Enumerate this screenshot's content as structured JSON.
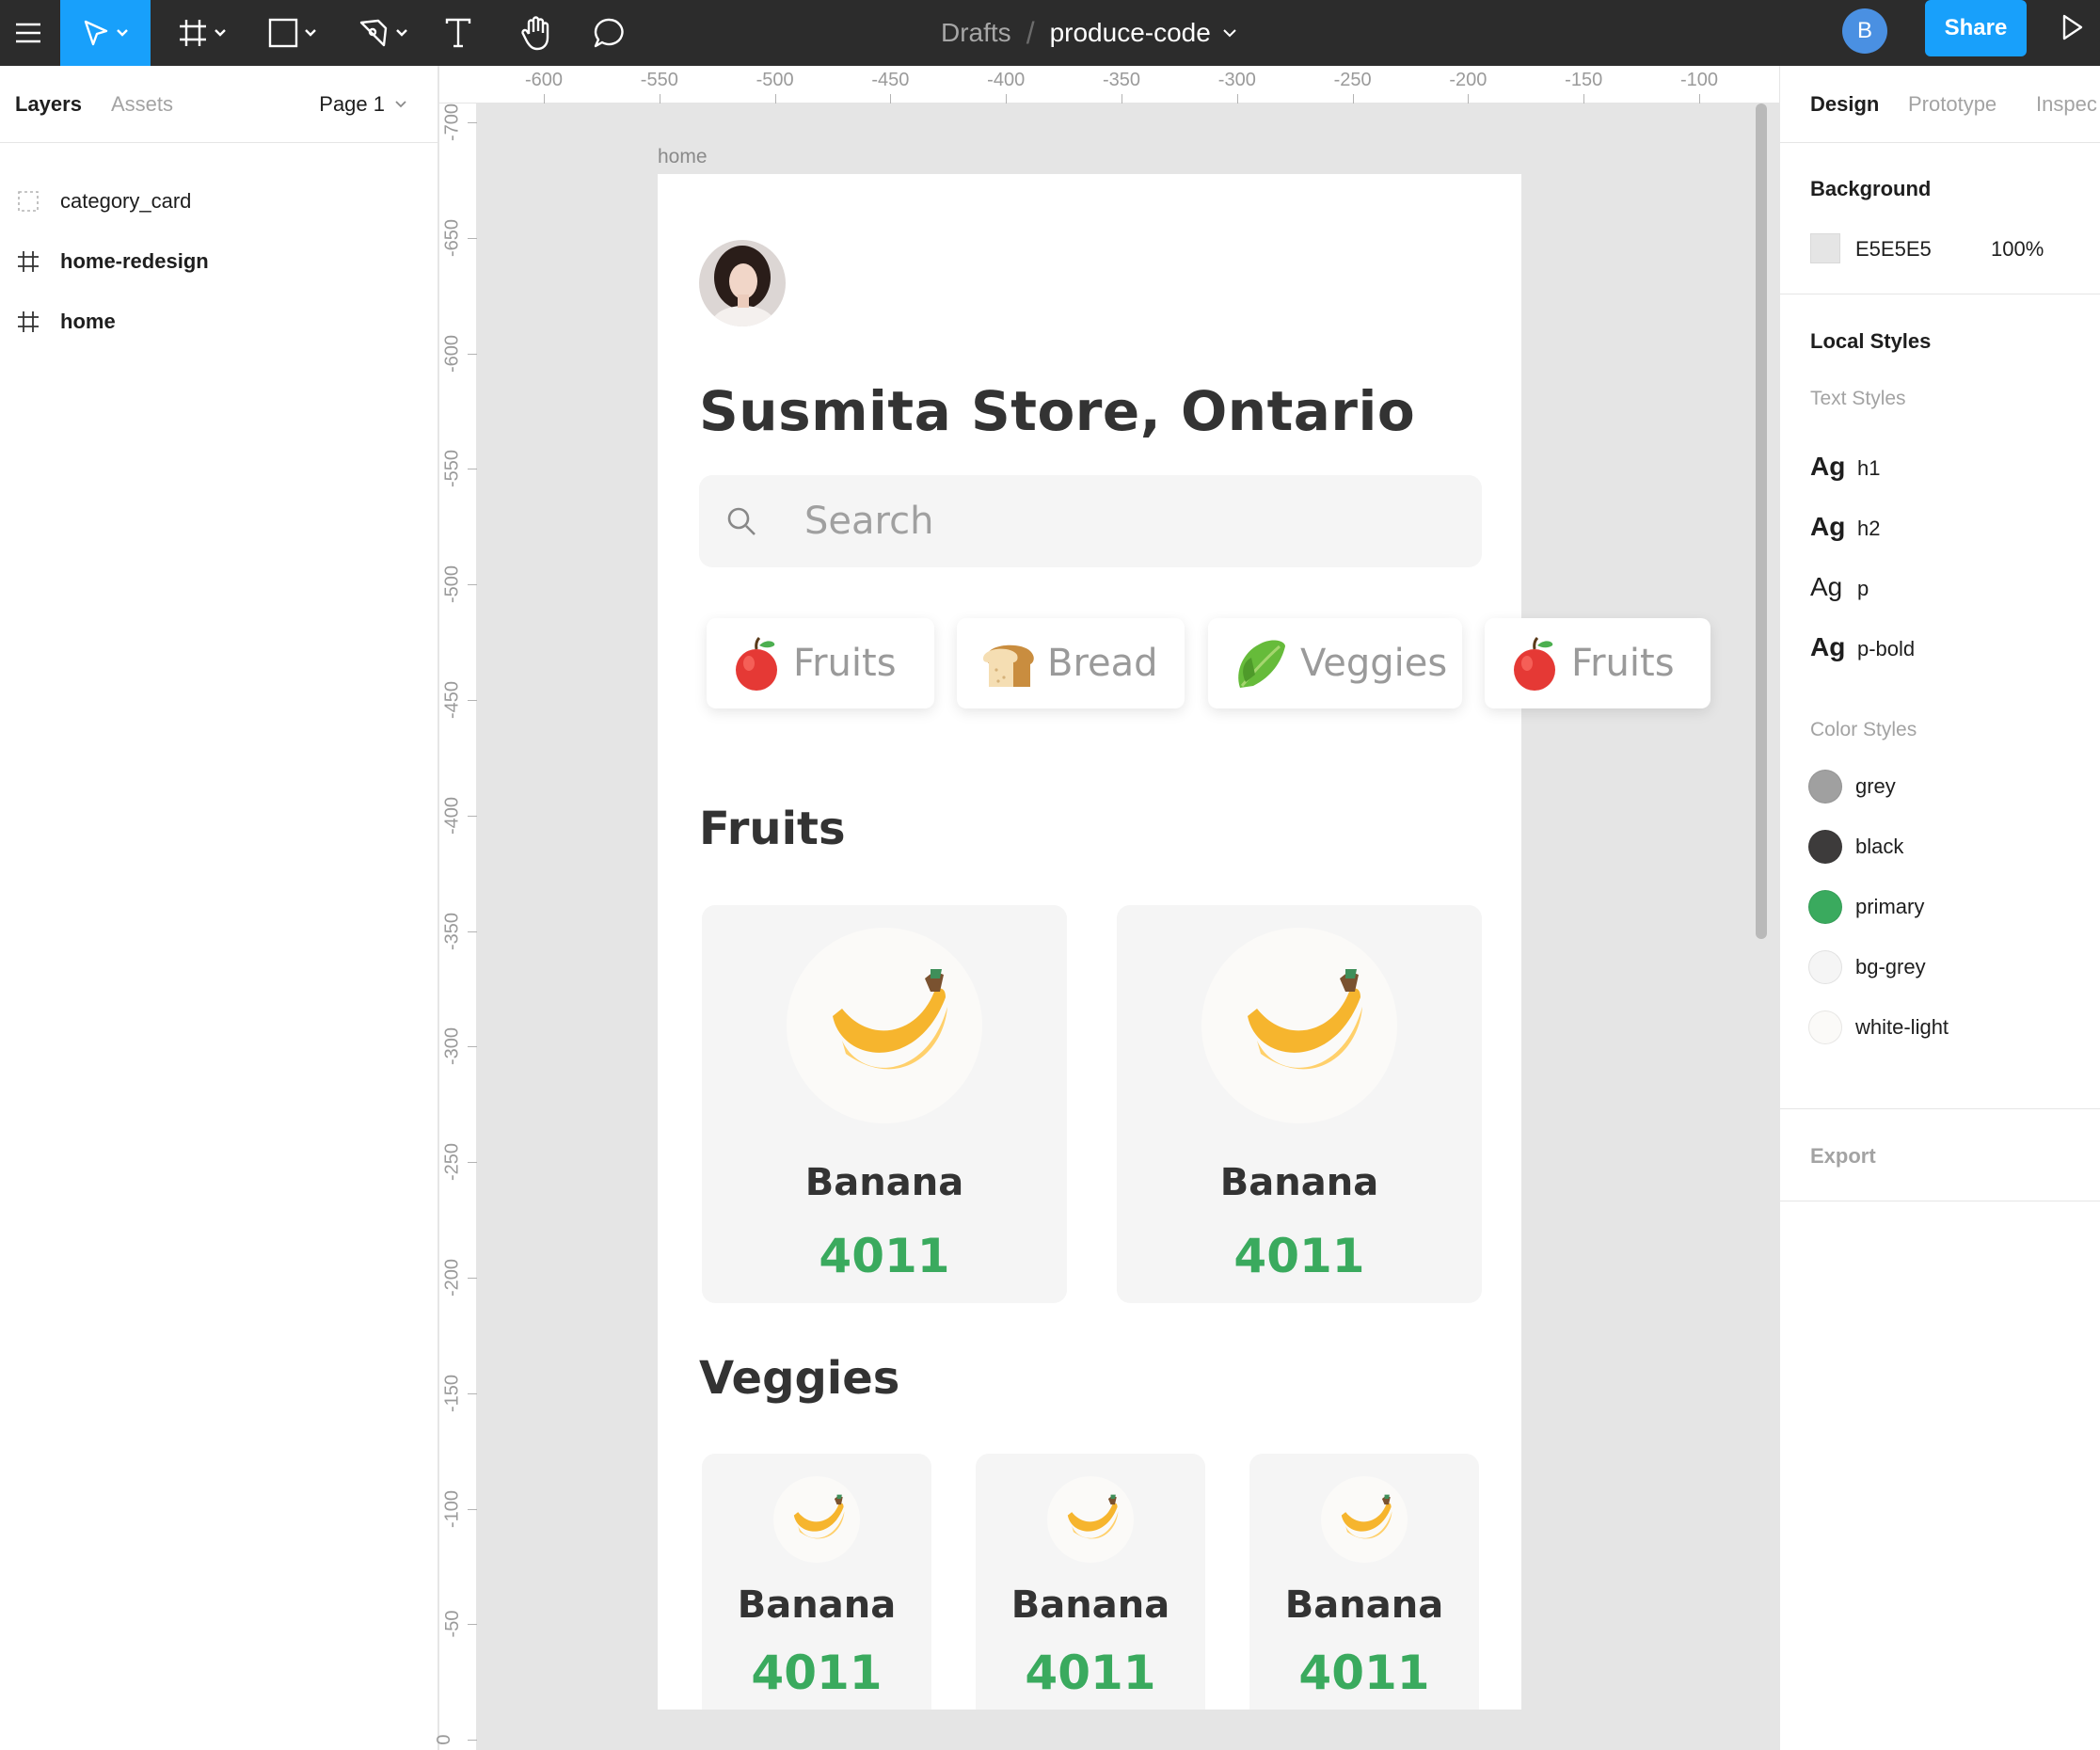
{
  "toolbar": {
    "breadcrumb_drafts": "Drafts",
    "breadcrumb_separator": "/",
    "file_name": "produce-code",
    "user_initial": "B",
    "share_label": "Share",
    "accent_color": "#18a0fb",
    "icons": [
      "menu-icon",
      "move-tool-icon",
      "frame-tool-icon",
      "rectangle-tool-icon",
      "pen-tool-icon",
      "text-tool-icon",
      "hand-tool-icon",
      "comment-tool-icon",
      "present-icon"
    ]
  },
  "left_panel": {
    "tab_layers": "Layers",
    "tab_assets": "Assets",
    "page_label": "Page 1",
    "layers": [
      {
        "name": "category_card",
        "icon": "component-dashed-icon"
      },
      {
        "name": "home-redesign",
        "icon": "frame-hash-icon"
      },
      {
        "name": "home",
        "icon": "frame-hash-icon"
      }
    ]
  },
  "rulers": {
    "top": [
      "-600",
      "-550",
      "-500",
      "-450",
      "-400",
      "-350",
      "-300",
      "-250",
      "-200",
      "-150",
      "-100"
    ],
    "left": [
      "-700",
      "-650",
      "-600",
      "-550",
      "-500",
      "-450",
      "-400",
      "-350",
      "-300",
      "-250",
      "-200",
      "-150",
      "-100",
      "-50",
      "0"
    ]
  },
  "canvas": {
    "frame_label": "home",
    "store_title": "Susmita Store, Ontario",
    "search_placeholder": "Search",
    "chips": [
      {
        "label": "Fruits",
        "icon": "apple-icon"
      },
      {
        "label": "Bread",
        "icon": "bread-icon"
      },
      {
        "label": "Veggies",
        "icon": "lettuce-icon"
      },
      {
        "label": "Fruits",
        "icon": "apple-icon"
      }
    ],
    "section_fruits": "Fruits",
    "section_veggies": "Veggies",
    "fruit_cards": [
      {
        "name": "Banana",
        "code": "4011",
        "icon": "banana-icon"
      },
      {
        "name": "Banana",
        "code": "4011",
        "icon": "banana-icon"
      }
    ],
    "veggie_cards": [
      {
        "name": "Banana",
        "code": "4011",
        "icon": "banana-icon"
      },
      {
        "name": "Banana",
        "code": "4011",
        "icon": "banana-icon"
      },
      {
        "name": "Banana",
        "code": "4011",
        "icon": "banana-icon"
      }
    ],
    "primary_color": "#3aaa5e"
  },
  "right_panel": {
    "tab_design": "Design",
    "tab_prototype": "Prototype",
    "tab_inspect": "Inspec",
    "background_heading": "Background",
    "background_hex": "E5E5E5",
    "background_opacity": "100%",
    "local_styles_heading": "Local Styles",
    "text_styles_heading": "Text Styles",
    "text_styles": [
      {
        "sample": "Ag",
        "name": "h1"
      },
      {
        "sample": "Ag",
        "name": "h2"
      },
      {
        "sample": "Ag",
        "name": "p"
      },
      {
        "sample": "Ag",
        "name": "p-bold"
      }
    ],
    "color_styles_heading": "Color Styles",
    "color_styles": [
      {
        "name": "grey",
        "hex": "#a0a0a0"
      },
      {
        "name": "black",
        "hex": "#3d3b3b"
      },
      {
        "name": "primary",
        "hex": "#3aaa5e"
      },
      {
        "name": "bg-grey",
        "hex": "#f5f5f5"
      },
      {
        "name": "white-light",
        "hex": "#fbfaf8"
      }
    ],
    "export_label": "Export"
  }
}
